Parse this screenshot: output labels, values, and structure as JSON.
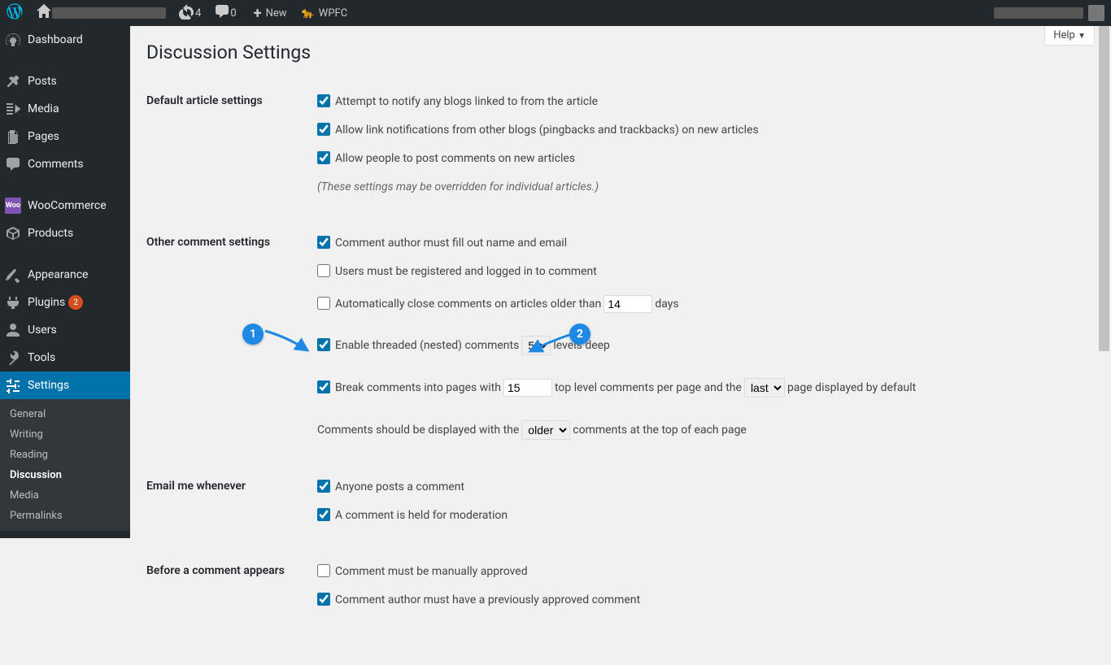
{
  "adminbar": {
    "update_count": "4",
    "comment_count": "0",
    "new_label": "New",
    "wpfc_label": "WPFC"
  },
  "menu": {
    "dashboard": "Dashboard",
    "posts": "Posts",
    "media": "Media",
    "pages": "Pages",
    "comments": "Comments",
    "woocommerce": "WooCommerce",
    "products": "Products",
    "appearance": "Appearance",
    "plugins": "Plugins",
    "plugins_badge": "2",
    "users": "Users",
    "tools": "Tools",
    "settings": "Settings"
  },
  "submenu": {
    "general": "General",
    "writing": "Writing",
    "reading": "Reading",
    "discussion": "Discussion",
    "media": "Media",
    "permalinks": "Permalinks"
  },
  "page": {
    "help": "Help",
    "title": "Discussion Settings",
    "sections": {
      "default_article": "Default article settings",
      "other_comment": "Other comment settings",
      "email_me": "Email me whenever",
      "before_comment": "Before a comment appears"
    },
    "opts": {
      "notify_blogs": "Attempt to notify any blogs linked to from the article",
      "allow_pingbacks": "Allow link notifications from other blogs (pingbacks and trackbacks) on new articles",
      "allow_comments": "Allow people to post comments on new articles",
      "override_note": "(These settings may be overridden for individual articles.)",
      "require_name_email": "Comment author must fill out name and email",
      "require_registered": "Users must be registered and logged in to comment",
      "close_old_pre": "Automatically close comments on articles older than",
      "close_old_days": "14",
      "close_old_post": "days",
      "threaded_pre": "Enable threaded (nested) comments",
      "threaded_levels": "5",
      "threaded_post": "levels deep",
      "paginate_pre": "Break comments into pages with",
      "paginate_count": "15",
      "paginate_mid": "top level comments per page and the",
      "paginate_default": "last",
      "paginate_post": "page displayed by default",
      "order_pre": "Comments should be displayed with the",
      "order_value": "older",
      "order_post": "comments at the top of each page",
      "anyone_posts": "Anyone posts a comment",
      "held_moderation": "A comment is held for moderation",
      "manually_approved": "Comment must be manually approved",
      "prev_approved": "Comment author must have a previously approved comment"
    }
  },
  "annotations": {
    "one": "1",
    "two": "2"
  }
}
